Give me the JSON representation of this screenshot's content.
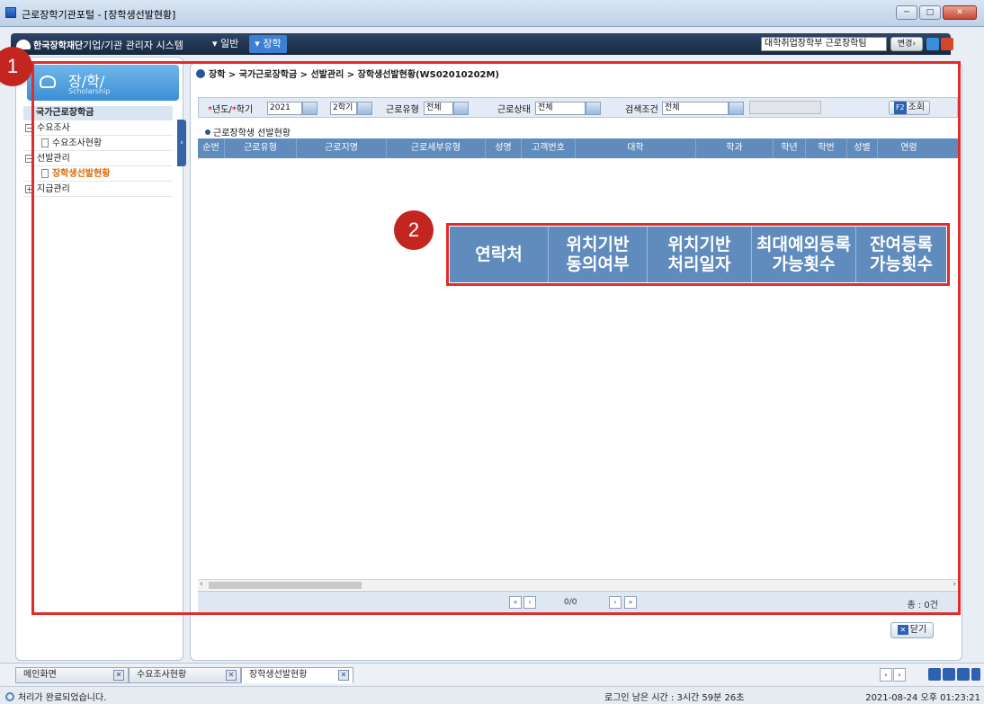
{
  "window": {
    "title": "근로장학기관포털 - [장학생선발현황]"
  },
  "appbar": {
    "logo_text": "한국장학재단",
    "system_title": "기업/기관 관리자 시스템",
    "menu": [
      "일반",
      "장학"
    ],
    "dept": "대학취업장학부 근로장학팀",
    "change_label": "변경"
  },
  "sidebar": {
    "header_title": "장/학/",
    "header_sub": "Scholarship",
    "tree": [
      {
        "label": "국가근로장학금",
        "level": 0
      },
      {
        "label": "수요조사",
        "level": 1,
        "expanded": true
      },
      {
        "label": "수요조사현황",
        "level": 2
      },
      {
        "label": "선발관리",
        "level": 1,
        "expanded": true
      },
      {
        "label": "장학생선발현황",
        "level": 2,
        "selected": true
      },
      {
        "label": "지급관리",
        "level": 1,
        "expanded": false
      }
    ]
  },
  "breadcrumb": "장학 > 국가근로장학금 > 선발관리 > 장학생선발현황(WS02010202M)",
  "search": {
    "year_label": "년도/",
    "term_label": "학기",
    "year_value": "2021",
    "term_value": "2학기",
    "work_type_label": "근로유형",
    "work_type_value": "전체",
    "work_status_label": "근로상태",
    "work_status_value": "전체",
    "cond_label": "검색조건",
    "cond_value": "전체",
    "query_key": "F2",
    "query_label": "조회"
  },
  "grid": {
    "title": "근로장학생 선발현황",
    "columns": [
      "순번",
      "근로유형",
      "근로지명",
      "근로세부유형",
      "성명",
      "고객번호",
      "대학",
      "학과",
      "학년",
      "학번",
      "성별",
      "연령"
    ],
    "rows": []
  },
  "pager": {
    "info": "0/0",
    "total": "총 : 0건"
  },
  "close_label": "닫기",
  "annotations": {
    "badge1": "1",
    "badge2": "2",
    "zoom_columns": [
      "연락처",
      "위치기반\n동의여부",
      "위치기반\n처리일자",
      "최대예외등록\n가능횟수",
      "잔여등록\n가능횟수"
    ]
  },
  "taskbar": {
    "tabs": [
      "메인화면",
      "수요조사현황",
      "장학생선발현황"
    ],
    "active": 2
  },
  "status": {
    "message": "처리가 완료되었습니다.",
    "session": "로그인 남은 시간 : 3시간 59분 26초",
    "datetime": "2021-08-24 오후 01:23:21"
  },
  "colors": {
    "header_blue": "#5f8bbd",
    "annotation_red": "#e22b2b",
    "selected_orange": "#e06a00"
  }
}
